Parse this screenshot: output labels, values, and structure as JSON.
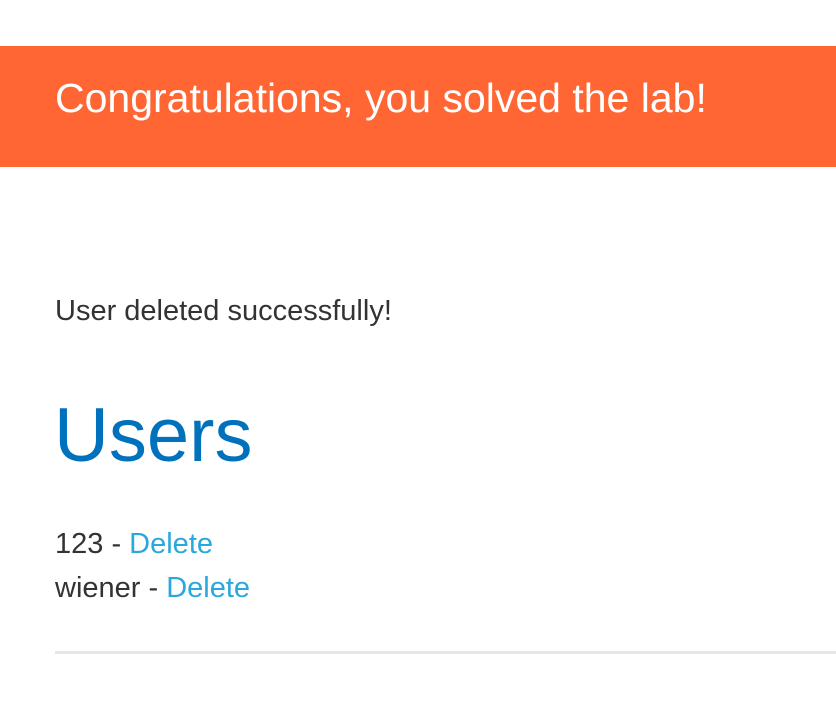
{
  "banner": {
    "text": "Congratulations, you solved the lab!",
    "color": "#ff6633"
  },
  "status": {
    "message": "User deleted successfully!"
  },
  "page": {
    "title": "Users",
    "title_color": "#0071bc",
    "link_color": "#29a8dd"
  },
  "users": [
    {
      "name": "123",
      "separator": " - ",
      "delete_label": "Delete"
    },
    {
      "name": "wiener",
      "separator": " - ",
      "delete_label": "Delete"
    }
  ]
}
